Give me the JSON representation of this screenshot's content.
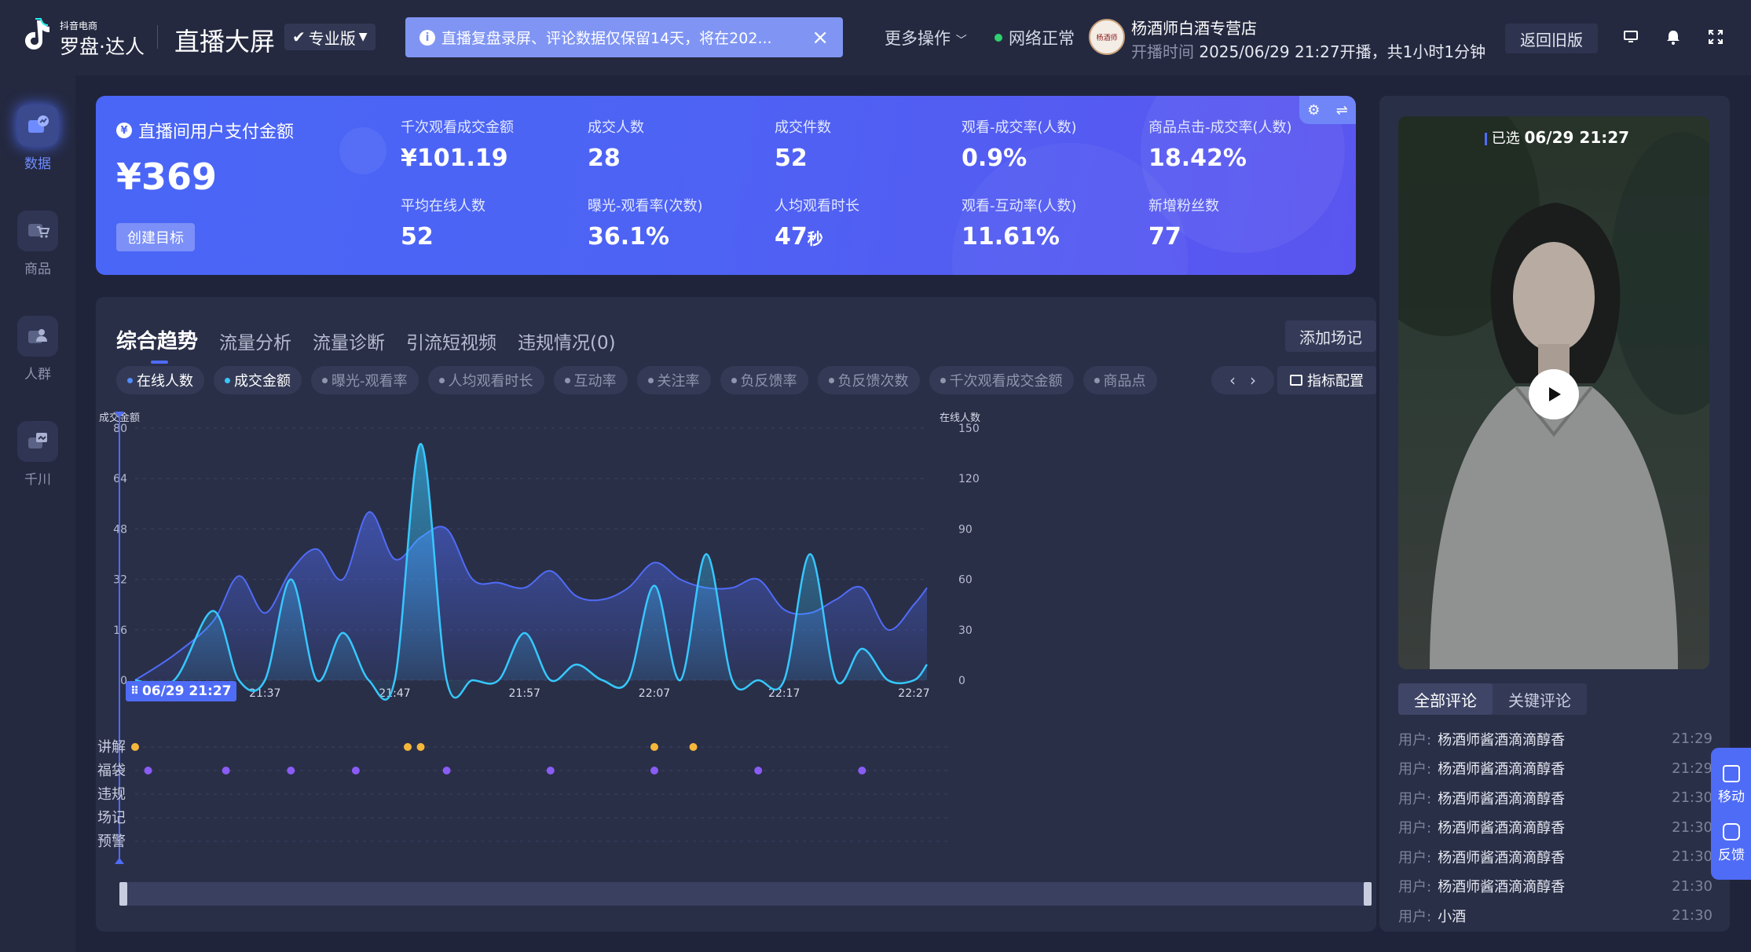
{
  "header": {
    "brand_small": "抖音电商",
    "brand_big": "罗盘·达人",
    "app_title": "直播大屏",
    "edition": "专业版",
    "notice": "直播复盘录屏、评论数据仅保留14天，将在202...",
    "more_ops": "更多操作",
    "network": "网络正常",
    "avatar_text": "杨酒师",
    "shop_name": "杨酒师白酒专营店",
    "open_time_label": "开播时间",
    "open_time_value": "2025/06/29 21:27开播，共1小时1分钟",
    "back_old": "返回旧版",
    "icons": [
      "monitor-icon",
      "bell-icon",
      "fullscreen-icon"
    ]
  },
  "nav": [
    {
      "label": "数据",
      "icon": "data-icon",
      "active": true
    },
    {
      "label": "商品",
      "icon": "cart-icon",
      "active": false
    },
    {
      "label": "人群",
      "icon": "people-icon",
      "active": false
    },
    {
      "label": "千川",
      "icon": "qianchuan-icon",
      "active": false
    }
  ],
  "summary": {
    "pay_title": "直播间用户支付金额",
    "pay_value": "¥369",
    "goal_button": "创建目标",
    "metrics": [
      {
        "label": "千次观看成交金额",
        "value": "¥101.19"
      },
      {
        "label": "成交人数",
        "value": "28"
      },
      {
        "label": "成交件数",
        "value": "52"
      },
      {
        "label": "观看-成交率(人数)",
        "value": "0.9%"
      },
      {
        "label": "商品点击-成交率(人数)",
        "value": "18.42%"
      },
      {
        "label": "平均在线人数",
        "value": "52"
      },
      {
        "label": "曝光-观看率(次数)",
        "value": "36.1%"
      },
      {
        "label": "人均观看时长",
        "value": "47",
        "unit": "秒"
      },
      {
        "label": "观看-互动率(人数)",
        "value": "11.61%"
      },
      {
        "label": "新增粉丝数",
        "value": "77"
      }
    ]
  },
  "trend": {
    "tabs": [
      "综合趋势",
      "流量分析",
      "流量诊断",
      "引流短视频",
      "违规情况(0)"
    ],
    "add_note": "添加场记",
    "chips": [
      "在线人数",
      "成交金额",
      "曝光-观看率",
      "人均观看时长",
      "互动率",
      "关注率",
      "负反馈率",
      "负反馈次数",
      "千次观看成交金额",
      "商品点"
    ],
    "config_button": "指标配置",
    "current_time": "06/29 21:27",
    "event_rows": [
      "讲解",
      "福袋",
      "违规",
      "场记",
      "预警"
    ]
  },
  "chart_data": {
    "type": "area",
    "x": [
      "21:27",
      "21:30",
      "21:33",
      "21:35",
      "21:37",
      "21:39",
      "21:41",
      "21:43",
      "21:45",
      "21:47",
      "21:49",
      "21:51",
      "21:53",
      "21:55",
      "21:57",
      "21:59",
      "22:01",
      "22:03",
      "22:05",
      "22:07",
      "22:09",
      "22:11",
      "22:13",
      "22:15",
      "22:17",
      "22:19",
      "22:21",
      "22:23",
      "22:25",
      "22:27",
      "22:28"
    ],
    "x_ticks": [
      "21:37",
      "21:47",
      "21:57",
      "22:07",
      "22:17",
      "22:27"
    ],
    "left_axis": {
      "label": "成交金额",
      "ylim": [
        0,
        80
      ],
      "ticks": [
        0,
        16,
        32,
        48,
        64,
        80
      ]
    },
    "right_axis": {
      "label": "在线人数",
      "ylim": [
        0,
        150
      ],
      "ticks": [
        0,
        30,
        60,
        90,
        120,
        150
      ]
    },
    "series": [
      {
        "name": "在线人数",
        "axis": "right",
        "color": "#4f6cf7",
        "values": [
          0,
          15,
          35,
          62,
          40,
          65,
          78,
          60,
          100,
          72,
          85,
          90,
          60,
          58,
          55,
          65,
          50,
          48,
          55,
          70,
          60,
          55,
          55,
          60,
          42,
          40,
          48,
          55,
          30,
          45,
          55
        ]
      },
      {
        "name": "成交金额",
        "axis": "left",
        "color": "#36c8ff",
        "values": [
          0,
          0,
          22,
          0,
          0,
          32,
          0,
          15,
          0,
          0,
          75,
          0,
          0,
          0,
          15,
          0,
          5,
          0,
          0,
          30,
          0,
          40,
          0,
          0,
          0,
          40,
          0,
          10,
          0,
          0,
          5
        ]
      }
    ],
    "events": {
      "讲解": [
        "21:27",
        "21:48",
        "21:49",
        "22:07",
        "22:10"
      ],
      "福袋": [
        "21:28",
        "21:34",
        "21:39",
        "21:44",
        "21:51",
        "21:59",
        "22:07",
        "22:15",
        "22:23"
      ]
    },
    "grid": true,
    "legend": "top"
  },
  "video": {
    "selected_label": "已选",
    "selected_time": "06/29 21:27"
  },
  "comments": {
    "tabs": [
      "全部评论",
      "关键评论"
    ],
    "user_label": "用户:",
    "items": [
      {
        "name": "杨酒师酱酒滴滴醇香",
        "time": "21:29"
      },
      {
        "name": "杨酒师酱酒滴滴醇香",
        "time": "21:29"
      },
      {
        "name": "杨酒师酱酒滴滴醇香",
        "time": "21:30"
      },
      {
        "name": "杨酒师酱酒滴滴醇香",
        "time": "21:30"
      },
      {
        "name": "杨酒师酱酒滴滴醇香",
        "time": "21:30"
      },
      {
        "name": "杨酒师酱酒滴滴醇香",
        "time": "21:30"
      },
      {
        "name": "小酒",
        "time": "21:30"
      }
    ]
  },
  "float_bar": [
    {
      "label": "移动",
      "icon": "mobile-icon"
    },
    {
      "label": "反馈",
      "icon": "feedback-icon"
    }
  ],
  "colors": {
    "accent": "#4f6cf7",
    "deal_line": "#36c8ff",
    "explain_dot": "#f5b73b",
    "luckybag_dot": "#8a5cf5",
    "network_ok": "#2fd06f"
  }
}
